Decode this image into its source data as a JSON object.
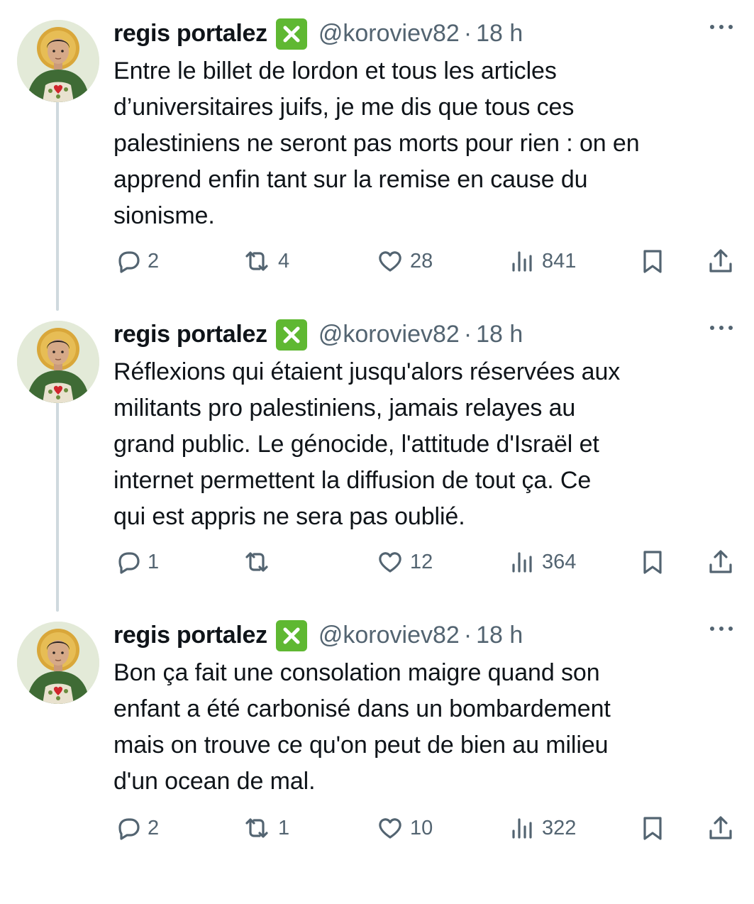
{
  "tweets": [
    {
      "author": {
        "name": "regis portalez",
        "badge": "✕",
        "handle": "@koroviev82",
        "separator": "·",
        "time": "18 h"
      },
      "text": "Entre le billet de lordon et tous les articles\nd’universitaires juifs, je me dis que tous ces\npalestiniens ne seront pas morts pour rien : on en\napprend enfin tant sur la remise en cause du\nsionisme.",
      "stats": {
        "replies": "2",
        "reposts": "4",
        "likes": "28",
        "views": "841"
      }
    },
    {
      "author": {
        "name": "regis portalez",
        "badge": "✕",
        "handle": "@koroviev82",
        "separator": "·",
        "time": "18 h"
      },
      "text": "Réflexions qui étaient jusqu'alors réservées aux\nmilitants pro palestiniens, jamais relayes au\ngrand public. Le génocide, l'attitude d'Israël et\ninternet permettent la diffusion de tout ça. Ce\nqui est appris ne sera pas oublié.",
      "stats": {
        "replies": "1",
        "reposts": "",
        "likes": "12",
        "views": "364"
      }
    },
    {
      "author": {
        "name": "regis portalez",
        "badge": "✕",
        "handle": "@koroviev82",
        "separator": "·",
        "time": "18 h"
      },
      "text": "Bon ça fait une consolation maigre quand son\nenfant a été carbonisé dans un bombardement\nmais on trouve ce qu'on peut de bien au milieu\nd'un ocean de mal.",
      "stats": {
        "replies": "2",
        "reposts": "1",
        "likes": "10",
        "views": "322"
      }
    }
  ],
  "icons": {
    "avatar": "saint-portrait-avatar",
    "badge": "green-cross-emoji-badge",
    "more": "more-options-icon",
    "reply": "reply-icon",
    "repost": "repost-icon",
    "like": "heart-icon",
    "views": "views-icon",
    "bookmark": "bookmark-icon",
    "share": "share-icon"
  },
  "colors": {
    "text": "#0f1419",
    "secondary": "#536471",
    "thread_line": "#cfd9de",
    "badge_green": "#5fb832",
    "halo": "#d9a73a",
    "robe": "#3f6b35",
    "heart": "#d1252c"
  }
}
